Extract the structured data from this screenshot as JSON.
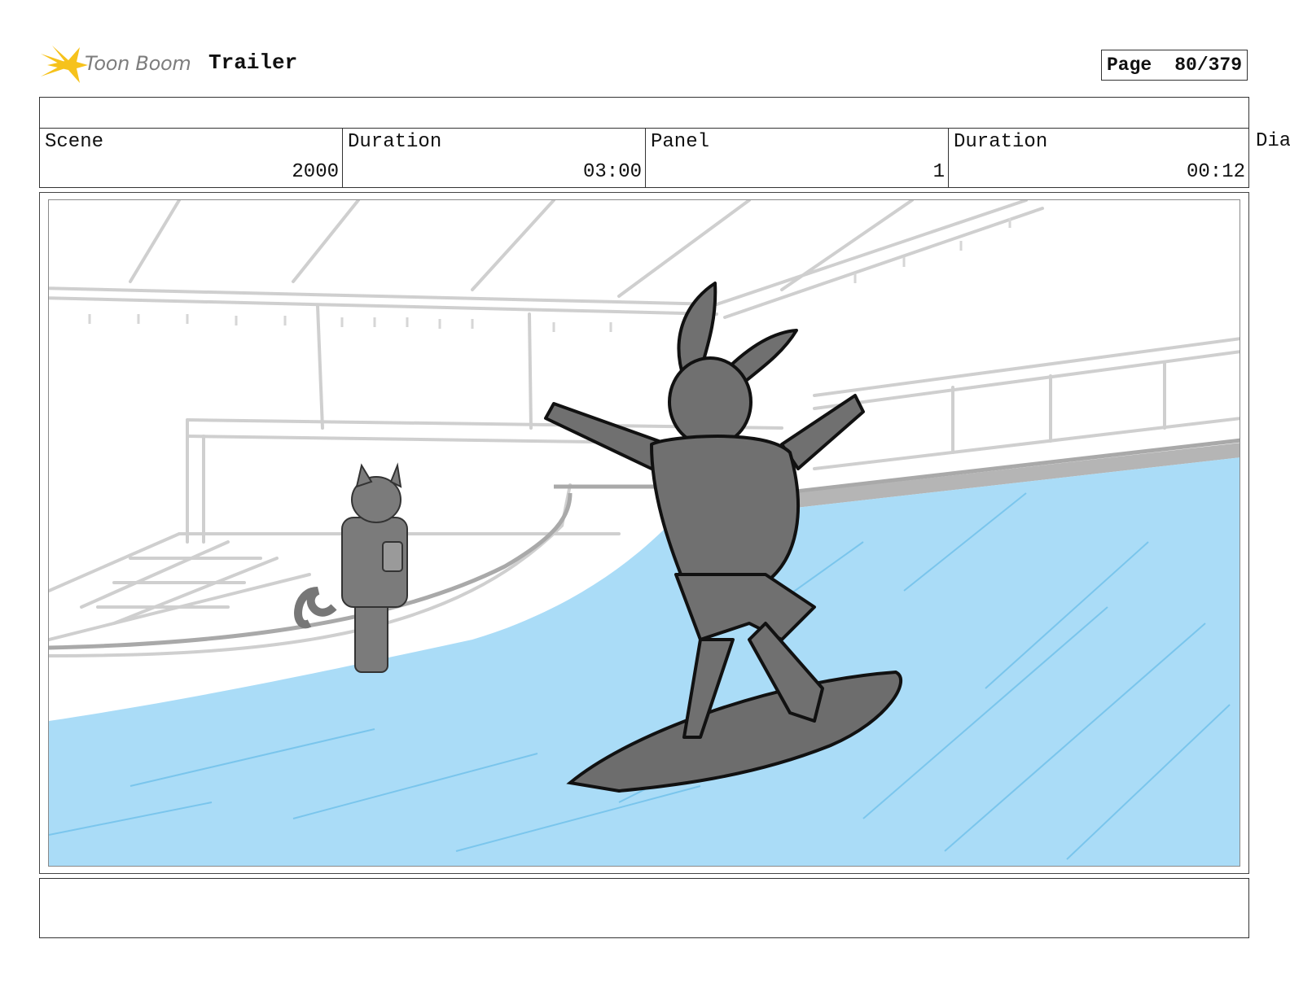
{
  "header": {
    "logo_text": "Toon Boom",
    "project_title": "Trailer",
    "page_label": "Page",
    "page_value": "80/379"
  },
  "fields": {
    "scene_label": "Scene",
    "scene_value": "2000",
    "scene_duration_label": "Duration",
    "scene_duration_value": "03:00",
    "panel_label": "Panel",
    "panel_value": "1",
    "panel_duration_label": "Duration",
    "panel_duration_value": "00:12",
    "dialog_label_cut": "Dia"
  },
  "colors": {
    "water": "#aadcf7",
    "water_stroke": "#5ab4e6",
    "character_fill": "#707070",
    "background_lines": "#c8c8c8",
    "logo_star": "#f6c21c"
  }
}
